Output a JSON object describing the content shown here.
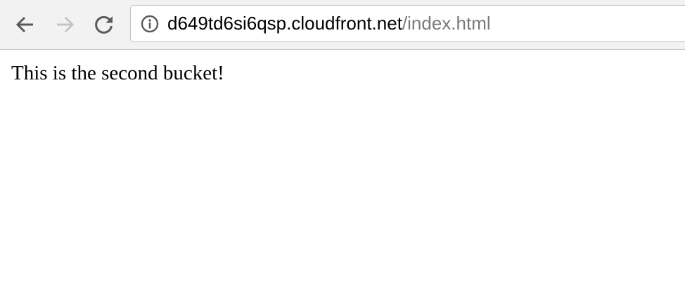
{
  "browser": {
    "toolbar": {
      "back_icon": "arrow-left-icon",
      "forward_icon": "arrow-right-icon",
      "reload_icon": "reload-icon",
      "forward_enabled": false
    },
    "address_bar": {
      "security_icon": "info-icon",
      "host": "d649td6si6qsp.cloudfront.net",
      "path": "/index.html"
    }
  },
  "page": {
    "body_text": "This is the second bucket!"
  },
  "colors": {
    "toolbar_bg": "#f2f2f2",
    "icon_active": "#5a5a5a",
    "icon_disabled": "#c4c4c4",
    "url_host": "#000000",
    "url_path": "#7a7a7a"
  }
}
